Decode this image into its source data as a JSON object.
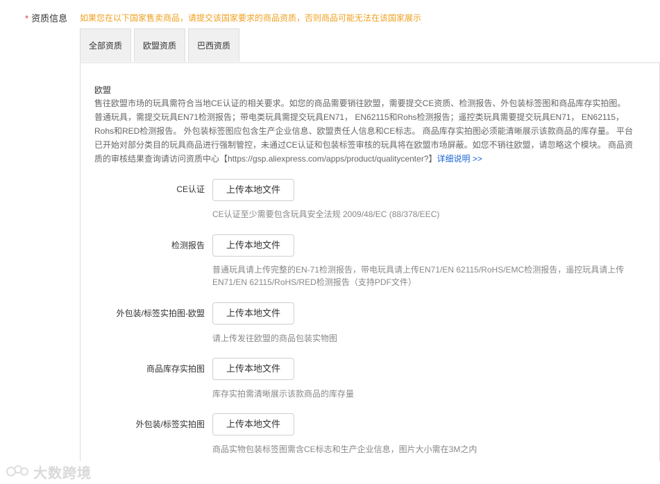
{
  "field": {
    "required_mark": "*",
    "label": "资质信息",
    "notice": "如果您在以下国家售卖商品，请提交该国家要求的商品资质，否则商品可能无法在该国家展示"
  },
  "tabs": [
    {
      "label": "全部资质"
    },
    {
      "label": "欧盟资质"
    },
    {
      "label": "巴西资质"
    }
  ],
  "region": {
    "title": "欧盟",
    "description": "售往欧盟市场的玩具需符合当地CE认证的相关要求。如您的商品需要销往欧盟，需要提交CE资质、检测报告、外包装标签图和商品库存实拍图。 普通玩具，需提交玩具EN71检测报告；带电类玩具需提交玩具EN71， EN62115和Rohs检测报告；遥控类玩具需要提交玩具EN71， EN62115， Rohs和RED检测报告。 外包装标签图应包含生产企业信息、欧盟责任人信息和CE标志。 商品库存实拍图必须能清晰展示该款商品的库存量。 平台已开始对部分类目的玩具商品进行强制管控，未通过CE认证和包装标签审核的玩具将在欧盟市场屏蔽。如您不销往欧盟，请忽略这个模块。 商品资质的审核结果查询请访问资质中心【https://gsp.aliexpress.com/apps/product/qualitycenter?】",
    "more_link": "详细说明 >>"
  },
  "rows": [
    {
      "label": "CE认证",
      "button": "上传本地文件",
      "hint": "CE认证至少需要包含玩具安全法规 2009/48/EC (88/378/EEC)"
    },
    {
      "label": "检测报告",
      "button": "上传本地文件",
      "hint": "普通玩具请上传完整的EN-71检测报告，带电玩具请上传EN71/EN 62115/RoHS/EMC检测报告，遥控玩具请上传EN71/EN 62115/RoHS/RED检测报告（支持PDF文件）"
    },
    {
      "label": "外包装/标签实拍图-欧盟",
      "button": "上传本地文件",
      "hint": "请上传发往欧盟的商品包装实物图"
    },
    {
      "label": "商品库存实拍图",
      "button": "上传本地文件",
      "hint": "库存实拍需清晰展示该款商品的库存量"
    },
    {
      "label": "外包装/标签实拍图",
      "button": "上传本地文件",
      "hint": "商品实物包装标签图需含CE标志和生产企业信息，图片大小需在3M之内"
    }
  ],
  "watermark": {
    "text": "大数跨境"
  },
  "colors": {
    "required": "#e4393c",
    "notice": "#f0a020",
    "link": "#1a66d2",
    "hint": "#888888"
  }
}
